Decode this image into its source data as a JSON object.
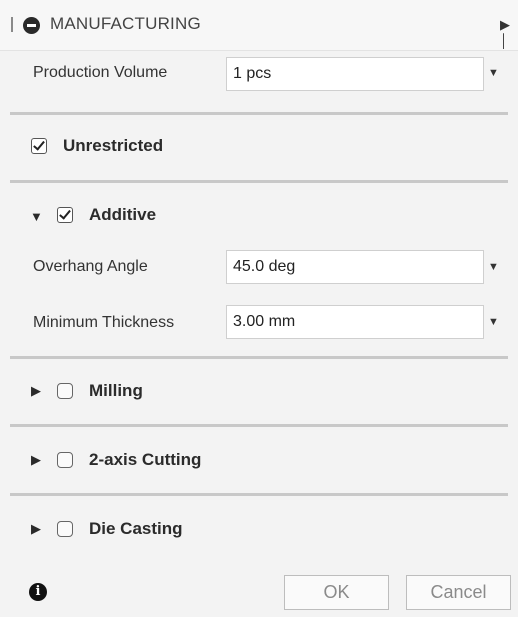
{
  "header": {
    "title": "MANUFACTURING",
    "collapse_icon": "minus-circle-icon",
    "expand_icon": "double-arrow-right-icon"
  },
  "production_volume": {
    "label": "Production Volume",
    "value": "1 pcs"
  },
  "sections": {
    "unrestricted": {
      "label": "Unrestricted",
      "checked": true
    },
    "additive": {
      "label": "Additive",
      "checked": true,
      "expanded": true,
      "overhang_angle": {
        "label": "Overhang Angle",
        "value": "45.0 deg"
      },
      "minimum_thickness": {
        "label": "Minimum Thickness",
        "value": "3.00 mm"
      }
    },
    "milling": {
      "label": "Milling",
      "checked": false,
      "expanded": false
    },
    "cutting": {
      "label": "2-axis Cutting",
      "checked": false,
      "expanded": false
    },
    "die_casting": {
      "label": "Die Casting",
      "checked": false,
      "expanded": false
    }
  },
  "footer": {
    "info_icon": "info-icon",
    "ok_label": "OK",
    "cancel_label": "Cancel"
  }
}
